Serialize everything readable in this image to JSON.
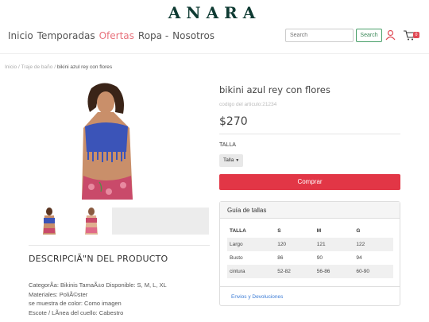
{
  "brand": {
    "logo": "ANARA"
  },
  "nav": [
    {
      "label": "Inicio",
      "active": false
    },
    {
      "label": "Temporadas",
      "active": false
    },
    {
      "label": "Ofertas",
      "active": true
    },
    {
      "label": "Ropa -",
      "active": false
    },
    {
      "label": "Nosotros",
      "active": false
    }
  ],
  "search": {
    "placeholder": "Search",
    "button": "Search"
  },
  "icons": {
    "user": "user-icon",
    "cart": "cart-icon"
  },
  "cart": {
    "count": "0"
  },
  "breadcrumb": {
    "home": "Inicio",
    "category": "Traje de baño",
    "current": "bikini azul rey con flores"
  },
  "product": {
    "name": "bikini azul rey con flores",
    "code": "codigo del articulo:21234",
    "price": "$270",
    "size_label": "TALLA",
    "size_select": "Talla",
    "buy": "Comprar"
  },
  "size_guide": {
    "title": "Guía de tallas",
    "headers": [
      "TALLA",
      "S",
      "M",
      "G"
    ],
    "rows": [
      [
        "Largo",
        "120",
        "121",
        "122"
      ],
      [
        "Busto",
        "86",
        "90",
        "94"
      ],
      [
        "cintura",
        "52-82",
        "56-86",
        "60-90"
      ]
    ],
    "shipping_link": "Envios y Devoluciones"
  },
  "description": {
    "title": "DESCRIPCIÃ\"N DEL PRODUCTO",
    "lines": [
      "CategorÃ­a: Bikinis TamaÃ±o Disponible: S, M, L, XL",
      "Materiales: PoliÃ©ster",
      "se muestra de color: Como imagen",
      "Escote / LÃ­nea del cuello: Cabestro"
    ]
  },
  "colors": {
    "accent": "#e23646",
    "brand": "#0f3b33",
    "nav_active": "#e8727c",
    "link": "#3a7bd5",
    "search_btn": "#3d8a5a"
  }
}
